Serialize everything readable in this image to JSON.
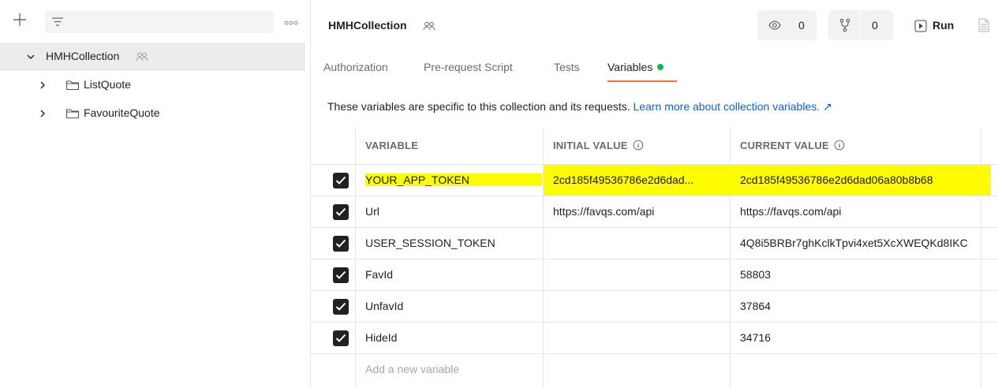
{
  "sidebar": {
    "tree": {
      "collection": {
        "name": "HMHCollection"
      },
      "folders": [
        {
          "name": "ListQuote"
        },
        {
          "name": "FavouriteQuote"
        }
      ]
    }
  },
  "header": {
    "title": "HMHCollection",
    "watch_count": "0",
    "fork_count": "0",
    "run_label": "Run"
  },
  "tabs": [
    {
      "label": "Authorization"
    },
    {
      "label": "Pre-request Script"
    },
    {
      "label": "Tests"
    },
    {
      "label": "Variables",
      "active": true
    }
  ],
  "info": {
    "text": "These variables are specific to this collection and its requests. ",
    "link": "Learn more about collection variables. ↗"
  },
  "table": {
    "headers": {
      "variable": "VARIABLE",
      "initial": "INITIAL VALUE",
      "current": "CURRENT VALUE"
    },
    "rows": [
      {
        "checked": true,
        "variable": "YOUR_APP_TOKEN",
        "initial": "2cd185f49536786e2d6dad...",
        "current": "2cd185f49536786e2d6dad06a80b8b68",
        "highlighted": true
      },
      {
        "checked": true,
        "variable": "Url",
        "initial": "https://favqs.com/api",
        "current": "https://favqs.com/api"
      },
      {
        "checked": true,
        "variable": "USER_SESSION_TOKEN",
        "initial": "",
        "current": "4Q8i5BRBr7ghKclkTpvi4xet5XcXWEQKd8IKC"
      },
      {
        "checked": true,
        "variable": "FavId",
        "initial": "",
        "current": "58803"
      },
      {
        "checked": true,
        "variable": "UnfavId",
        "initial": "",
        "current": "37864"
      },
      {
        "checked": true,
        "variable": "HideId",
        "initial": "",
        "current": "34716"
      }
    ],
    "add_placeholder": "Add a new variable"
  },
  "colors": {
    "accent": "#ff6c37",
    "link": "#0265d2",
    "status_dot": "#0cbb52",
    "highlight": "#fffc00"
  }
}
